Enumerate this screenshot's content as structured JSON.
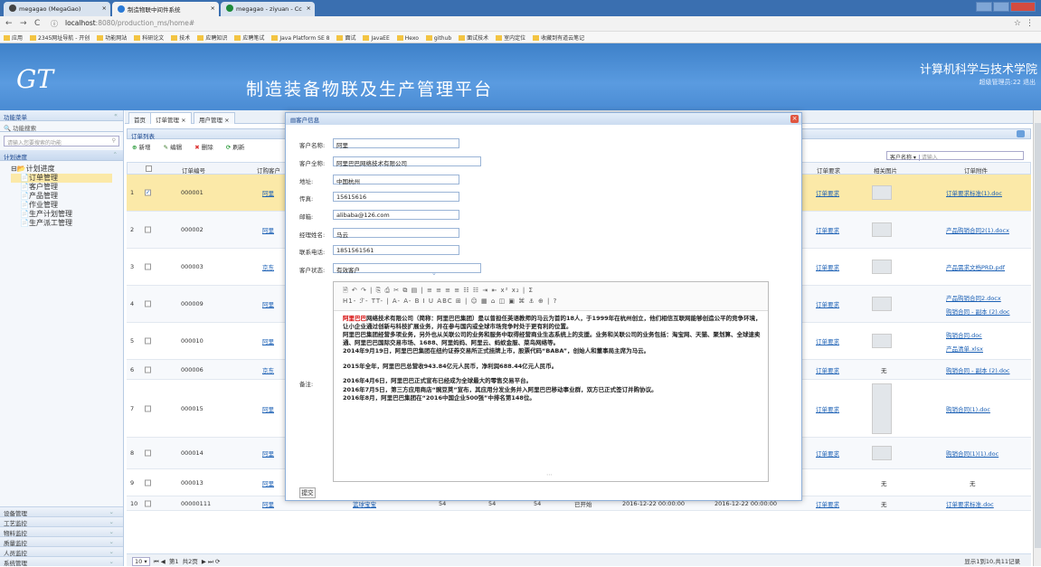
{
  "browser": {
    "tabs": [
      {
        "label": "megagao (MegaGao)"
      },
      {
        "label": "制造物联中间件系统"
      },
      {
        "label": "megagao - ziyuan - Cc"
      }
    ],
    "url_host": "localhost",
    "url_rest": ":8080/production_ms/home#",
    "bookmarks": [
      "应用",
      "2345网址导航 - 开创",
      "功能网站",
      "科研论文",
      "技术",
      "应聘知识",
      "应聘笔试",
      "Java Platform SE 8",
      "面试",
      "JavaEE",
      "Hexo",
      "github",
      "面试技术",
      "室内定位",
      "收藏到有道云笔记"
    ]
  },
  "header": {
    "logo": "GT",
    "title": "制造装备物联及生产管理平台",
    "college": "计算机科学与技术学院",
    "user": "超级管理员:22  退出"
  },
  "sidebar": {
    "menu_title": "功能菜单",
    "search_title": "功能搜索",
    "search_placeholder": "请输入您要搜索的功能",
    "section": "计划进度",
    "tree": [
      "计划进度",
      "订单管理",
      "客户管理",
      "产品管理",
      "作业管理",
      "生产计划管理",
      "生产派工管理"
    ],
    "bottom": [
      "设备管理",
      "工艺监控",
      "物料监控",
      "质量监控",
      "人员监控",
      "系统管理"
    ]
  },
  "main": {
    "tabs": [
      "首页",
      "订单管理 ×",
      "用户管理 ×"
    ],
    "grid_title": "订单列表",
    "toolbar": {
      "add": "新增",
      "edit": "编辑",
      "delete": "删除",
      "refresh": "刷新"
    },
    "search_select": "客户名称 ▾",
    "search_placeholder": "请输入",
    "columns": {
      "id": "订单编号",
      "customer": "订购客户",
      "req": "订单要求",
      "pic": "相关图片",
      "file": "订单附件"
    },
    "rows": [
      {
        "n": "1",
        "id": "000001",
        "cust": "阿里",
        "req": "订单要求",
        "file": "订单要求标准(1).doc",
        "file2": ""
      },
      {
        "n": "2",
        "id": "000002",
        "cust": "阿里",
        "req": "订单要求",
        "file": "产品购销合同2(1).docx",
        "file2": ""
      },
      {
        "n": "3",
        "id": "000003",
        "cust": "京东",
        "req": "订单要求",
        "file": "产品需求文档PRD.pdf",
        "file2": ""
      },
      {
        "n": "4",
        "id": "000009",
        "cust": "阿里",
        "req": "订单要求",
        "file": "产品购销合同2.docx",
        "file2": "购销合同 - 副本 (2).doc"
      },
      {
        "n": "5",
        "id": "000010",
        "cust": "阿里",
        "req": "订单要求",
        "file": "购销合同.doc",
        "file2": "产品清单.xlsx"
      },
      {
        "n": "6",
        "id": "000006",
        "cust": "京东",
        "req": "订单要求",
        "pic": "无",
        "file": "购销合同 - 副本 (2).doc",
        "file2": ""
      },
      {
        "n": "7",
        "id": "000015",
        "cust": "阿里",
        "req": "订单要求",
        "file": "购销合同(1).doc",
        "file2": ""
      },
      {
        "n": "8",
        "id": "000014",
        "cust": "阿里",
        "req": "订单要求",
        "file": "购销合同(1)(1).doc",
        "file2": ""
      },
      {
        "n": "9",
        "id": "000013",
        "cust": "阿里",
        "req": "",
        "pic": "无",
        "file": "无",
        "file2": ""
      },
      {
        "n": "10",
        "id": "00000111",
        "cust": "阿里",
        "product": "篮球宝宝",
        "q1": "54",
        "q2": "54",
        "q3": "54",
        "status": "已开始",
        "d1": "2016-12-22 00:00:00",
        "d2": "2016-12-22 00:00:00",
        "req": "订单要求",
        "pic": "无",
        "file": "订单要求标准.doc",
        "file2": ""
      }
    ],
    "pager": {
      "size": "10 ▾",
      "page": "第1",
      "total_pages": "共2页",
      "info": "显示1到10,共11记录"
    }
  },
  "dialog": {
    "title": "客户信息",
    "fields": [
      {
        "label": "客户名称:",
        "value": "阿里"
      },
      {
        "label": "客户全称:",
        "value": "阿里巴巴网络技术有限公司"
      },
      {
        "label": "地址:",
        "value": "中国杭州"
      },
      {
        "label": "传真:",
        "value": "15615616"
      },
      {
        "label": "邮箱:",
        "value": "alibaba@126.com"
      },
      {
        "label": "经理姓名:",
        "value": "马云"
      },
      {
        "label": "联系电话:",
        "value": "1851561561"
      },
      {
        "label": "客户状态:",
        "value": "有效客户"
      }
    ],
    "note_label": "备注:",
    "toolbar_row1": "🗎 ↶ ↷ | ⎘ ⎙ ✂ ⧉ ▤ | ≡ ≡ ≡ ≡ ☷ ☷ ⇥ ⇤ x² x₂ | Σ",
    "toolbar_row2": "H1- ℱ- TT- | A- A- B I U ABC ⊞ | ☺ ▦ ⌂ ◫ ▣ ⌘ ⚓ ⊕ | ?",
    "note": [
      {
        "pre": "阿里巴巴",
        "text": "网络技术有限公司（简称：阿里巴巴集团）是以曾担任英语教师的马云为首的18人，于1999年在杭州创立，他们相信互联网能够创造公平的竞争环境，让小企业通过创新与科技扩展业务，并在参与国内或全球市场竞争时处于更有利的位置。"
      },
      {
        "pre": "",
        "text": "阿里巴巴集团经营多项业务，另外也从关联公司的业务和服务中取得经营商业生态系统上的支援。业务和关联公司的业务包括：淘宝网、天猫、聚划算、全球速卖通、阿里巴巴国际交易市场、1688、阿里妈妈、阿里云、蚂蚁金服、菜鸟网络等。"
      },
      {
        "pre": "",
        "text": "2014年9月19日，阿里巴巴集团在纽约证券交易所正式挂牌上市，股票代码“BABA”，创始人和董事局主席为马云。"
      },
      {
        "pre": "",
        "text": "2015年全年，阿里巴巴总营收943.84亿元人民币，净利润688.44亿元人民币。"
      },
      {
        "pre": "",
        "text": "2016年4月6日，阿里巴巴正式宣布已经成为全球最大的零售交易平台。"
      },
      {
        "pre": "",
        "text": "2016年7月5日，第三方应用商店“豌豆荚”宣布，其应用分发业务并入阿里巴巴移动事业群，双方已正式签订并购协议。"
      },
      {
        "pre": "",
        "text": "2016年8月，阿里巴巴集团在“2016中国企业500强”中排名第148位。"
      }
    ],
    "submit": "提交"
  }
}
